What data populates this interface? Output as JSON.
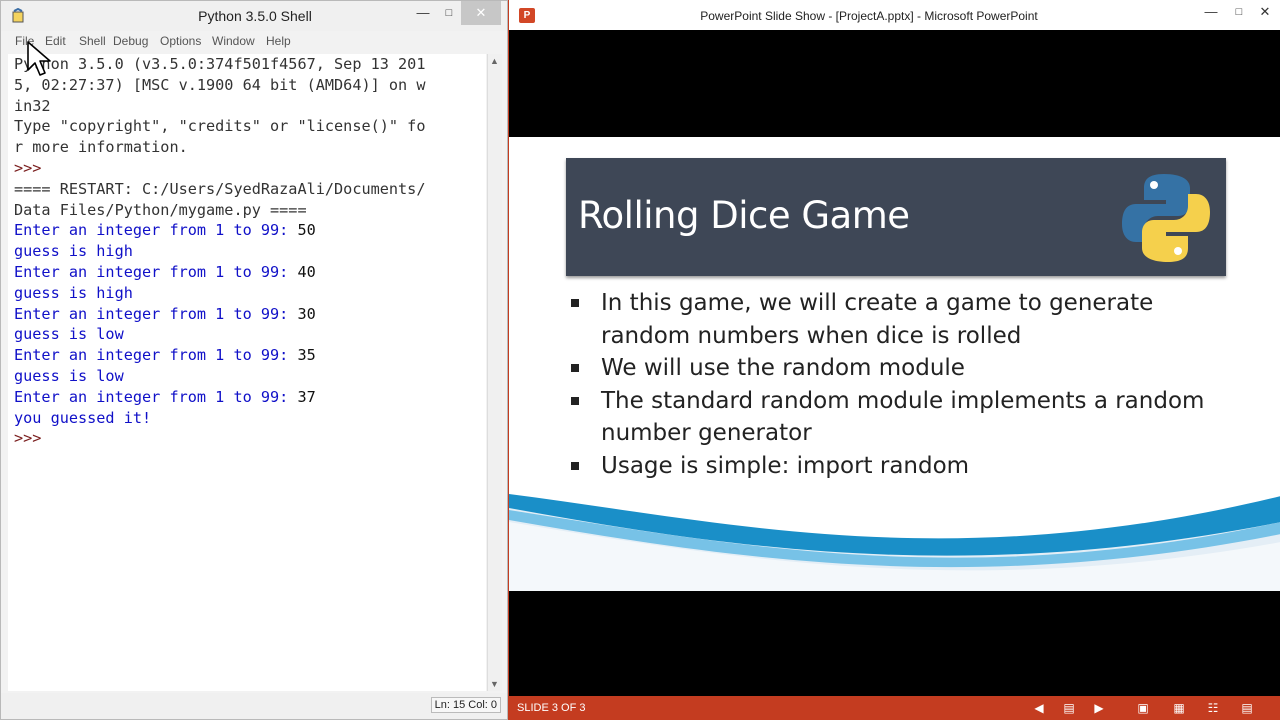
{
  "idle": {
    "title": "Python 3.5.0 Shell",
    "menu": [
      "File",
      "Edit",
      "Shell",
      "Debug",
      "Options",
      "Window",
      "Help"
    ],
    "lines": [
      {
        "text": "Python 3.5.0 (v3.5.0:374f501f4567, Sep 13 201",
        "kind": "out"
      },
      {
        "text": "5, 02:27:37) [MSC v.1900 64 bit (AMD64)] on w",
        "kind": "out"
      },
      {
        "text": "in32",
        "kind": "out"
      },
      {
        "text": "Type \"copyright\", \"credits\" or \"license()\" fo",
        "kind": "out"
      },
      {
        "text": "r more information.",
        "kind": "out"
      },
      {
        "text": ">>>",
        "kind": "prompt"
      },
      {
        "text": "==== RESTART: C:/Users/SyedRazaAli/Documents/",
        "kind": "out"
      },
      {
        "text": "Data Files/Python/mygame.py ====",
        "kind": "out"
      },
      {
        "text": "Enter an integer from 1 to 99:",
        "kind": "stdout",
        "input": " 50"
      },
      {
        "text": "guess is high",
        "kind": "stdout"
      },
      {
        "text": "Enter an integer from 1 to 99:",
        "kind": "stdout",
        "input": " 40"
      },
      {
        "text": "guess is high",
        "kind": "stdout"
      },
      {
        "text": "Enter an integer from 1 to 99:",
        "kind": "stdout",
        "input": " 30"
      },
      {
        "text": "guess is low",
        "kind": "stdout"
      },
      {
        "text": "Enter an integer from 1 to 99:",
        "kind": "stdout",
        "input": " 35"
      },
      {
        "text": "guess is low",
        "kind": "stdout"
      },
      {
        "text": "Enter an integer from 1 to 99:",
        "kind": "stdout",
        "input": " 37"
      },
      {
        "text": "you guessed it!",
        "kind": "stdout"
      },
      {
        "text": ">>>",
        "kind": "prompt"
      }
    ],
    "status": "Ln: 15 Col: 0"
  },
  "ppt": {
    "title": "PowerPoint Slide Show - [ProjectA.pptx] - Microsoft PowerPoint",
    "slide": {
      "title": "Rolling Dice Game",
      "bullets": [
        "In this game, we will create a game to generate random numbers when dice is rolled",
        "We will use the random module",
        "The standard random module implements a random number generator",
        "Usage is simple: import random"
      ]
    },
    "status": "SLIDE 3 OF 3",
    "accent": "#c43c20"
  }
}
